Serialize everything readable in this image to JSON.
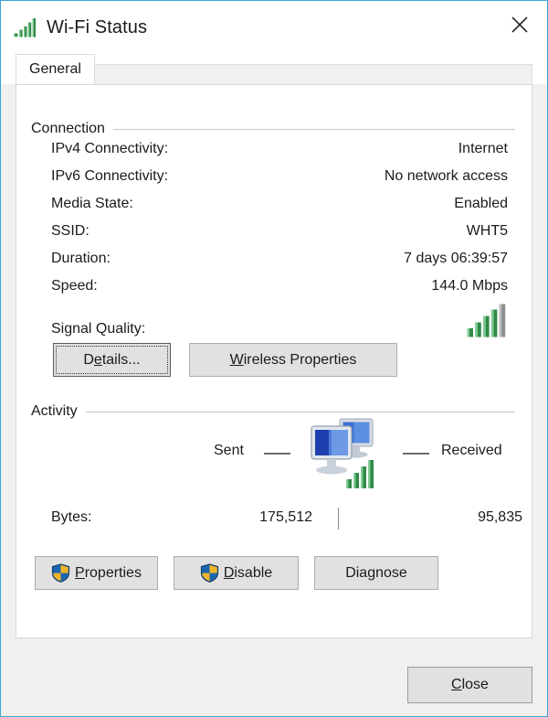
{
  "window": {
    "title": "Wi-Fi Status",
    "title_icon": "wifi-signal-icon",
    "close_icon": "close-icon",
    "accent_border_color": "#3ba7d8"
  },
  "tabs": [
    {
      "label": "General",
      "selected": true
    }
  ],
  "connection": {
    "group_label": "Connection",
    "rows": [
      {
        "label": "IPv4 Connectivity:",
        "value": "Internet"
      },
      {
        "label": "IPv6 Connectivity:",
        "value": "No network access"
      },
      {
        "label": "Media State:",
        "value": "Enabled"
      },
      {
        "label": "SSID:",
        "value": "WHT5"
      },
      {
        "label": "Duration:",
        "value": "7 days 06:39:57"
      },
      {
        "label": "Speed:",
        "value": "144.0 Mbps"
      }
    ],
    "signal_row": {
      "label": "Signal Quality:",
      "icon": "signal-bars-icon",
      "bars_total": 5,
      "bars_active": 4
    },
    "buttons": {
      "details": {
        "label": "Details...",
        "accel": "e",
        "focused": true
      },
      "wireless_properties": {
        "label": "Wireless Properties",
        "accel": "W",
        "focused": false
      }
    }
  },
  "activity": {
    "group_label": "Activity",
    "sent_label": "Sent",
    "received_label": "Received",
    "icon": "network-computers-icon",
    "bytes_label": "Bytes:",
    "bytes_sent": "175,512",
    "bytes_received": "95,835"
  },
  "actions": {
    "properties": {
      "label": "Properties",
      "accel": "P",
      "icon": "uac-shield-icon"
    },
    "disable": {
      "label": "Disable",
      "accel": "D",
      "icon": "uac-shield-icon"
    },
    "diagnose": {
      "label": "Diagnose",
      "accel": "g",
      "icon": null
    }
  },
  "footer": {
    "close": {
      "label": "Close",
      "accel": "C"
    }
  },
  "colors": {
    "signal_green": "#3f9c54",
    "signal_inactive": "#9a9a9a",
    "shield_blue": "#1b66b0",
    "shield_gold": "#f0b429",
    "monitor_blue": "#2a48b8"
  }
}
